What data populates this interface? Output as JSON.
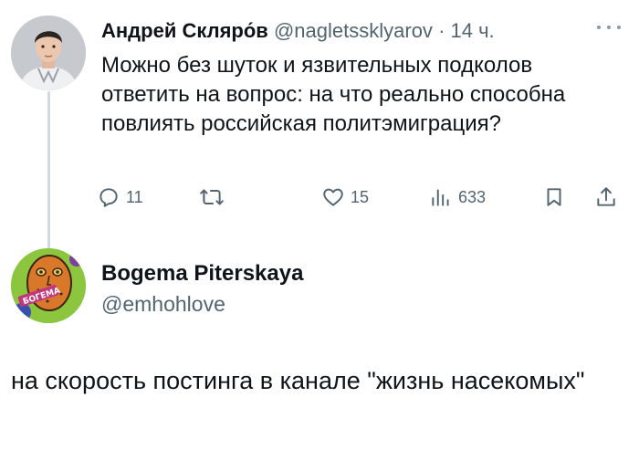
{
  "tweet1": {
    "author_name": "Андрей Скляро́в",
    "author_handle": "@nagletssklyarov",
    "separator": "·",
    "timestamp": "14 ч.",
    "text": "Можно без шуток и язвительных подколов ответить на вопрос: на что реально способна повлиять российская политэмиграция?",
    "actions": {
      "reply": {
        "icon": "reply-icon",
        "count": "11"
      },
      "retweet": {
        "icon": "retweet-icon",
        "count": ""
      },
      "like": {
        "icon": "heart-icon",
        "count": "15"
      },
      "views": {
        "icon": "views-icon",
        "count": "633"
      },
      "bookmark": {
        "icon": "bookmark-icon"
      },
      "share": {
        "icon": "share-icon"
      }
    }
  },
  "tweet2": {
    "author_name": "Bogema Piterskaya",
    "author_handle": "@emhohlove",
    "avatar_text": "БОГЕМА",
    "text": "на скорость постинга в канале \"жизнь насекомых\""
  },
  "colors": {
    "text_primary": "#0f1419",
    "text_secondary": "#536471",
    "thread_line": "#cfd9de"
  }
}
